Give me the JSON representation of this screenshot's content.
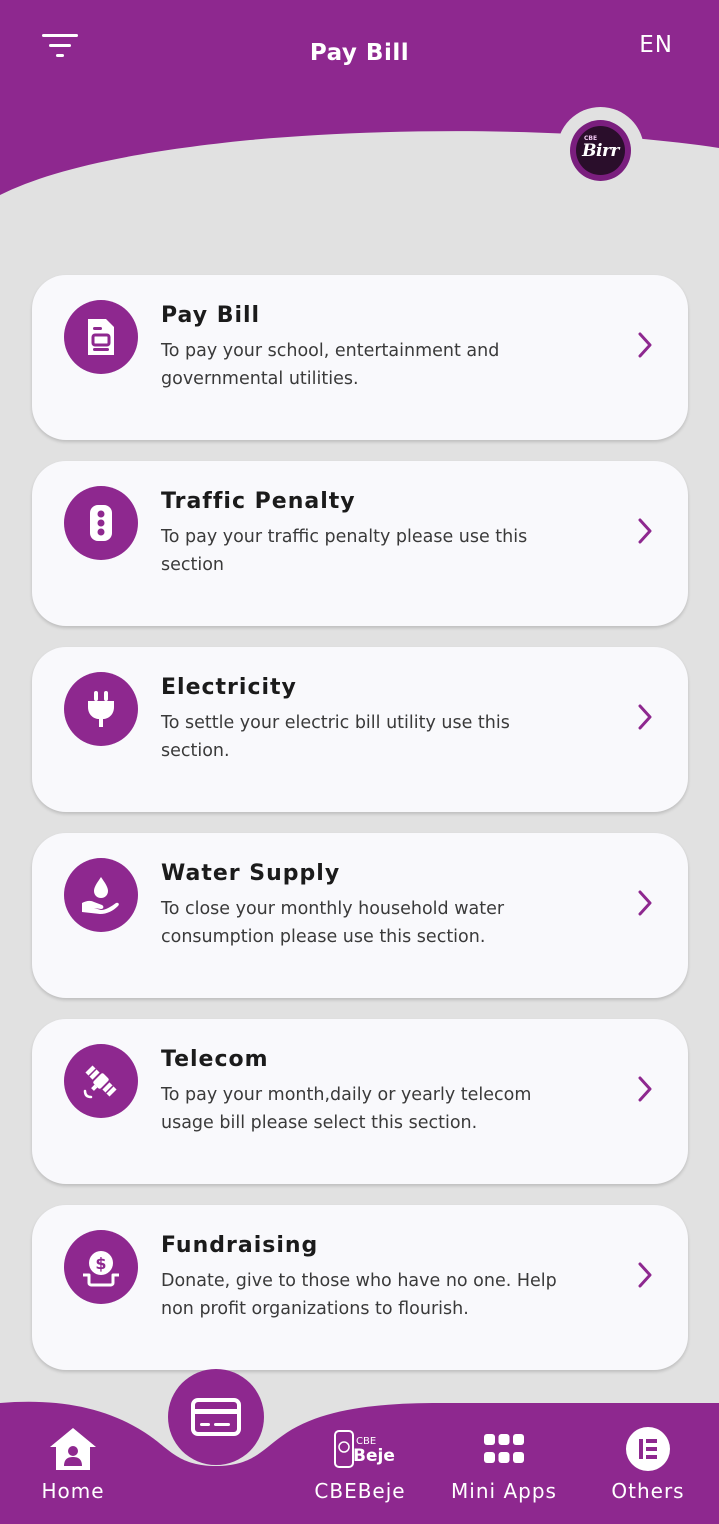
{
  "header": {
    "title": "Pay Bill",
    "language": "EN",
    "menu_icon": "filter-menu-icon",
    "brand_logo_text": "Birr",
    "brand_logo_sub": "CBE"
  },
  "colors": {
    "primary": "#8e288f",
    "background": "#e1e1e1",
    "card": "#f9f9fc"
  },
  "services": [
    {
      "title": "Pay Bill",
      "description": "To pay your school, entertainment and governmental utilities.",
      "icon": "bill-document-icon"
    },
    {
      "title": "Traffic Penalty",
      "description": "To pay your traffic penalty please use this section",
      "icon": "traffic-light-icon"
    },
    {
      "title": "Electricity",
      "description": "To settle your electric bill utility use this section.",
      "icon": "power-plug-icon"
    },
    {
      "title": "Water Supply",
      "description": "To close your monthly household water consumption please use this section.",
      "icon": "water-drop-hand-icon"
    },
    {
      "title": "Telecom",
      "description": "To pay your month,daily or yearly telecom usage bill please select this section.",
      "icon": "satellite-icon"
    },
    {
      "title": "Fundraising",
      "description": "Donate, give to those who have no one. Help non profit organizations to flourish.",
      "icon": "donation-icon"
    }
  ],
  "bottom_nav": {
    "home": "Home",
    "cbebeje": "CBEBeje",
    "cbebeje_logo_top": "CBE",
    "cbebeje_logo_main": "Beje",
    "mini_apps": "Mini Apps",
    "others": "Others",
    "center_action_icon": "card-icon"
  }
}
